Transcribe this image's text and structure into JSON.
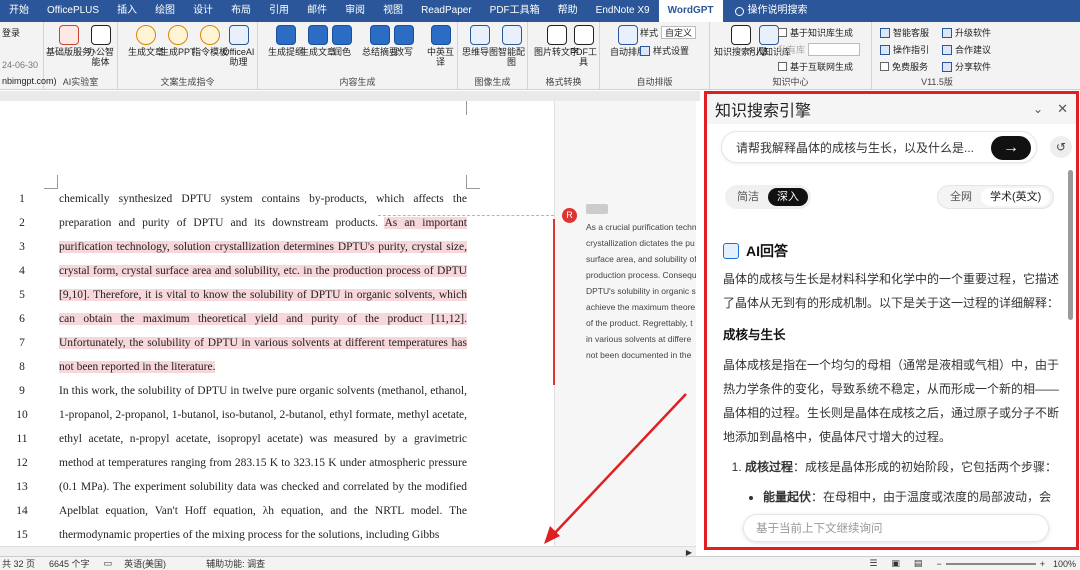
{
  "tabs": [
    "开始",
    "OfficePLUS",
    "插入",
    "绘图",
    "设计",
    "布局",
    "引用",
    "邮件",
    "审阅",
    "视图",
    "ReadPaper",
    "PDF工具箱",
    "帮助",
    "EndNote X9",
    "WordGPT",
    "操作说明搜索"
  ],
  "ribbon": {
    "login": {
      "text": "登录",
      "date": "24-06-30",
      "site": "nbimgpt.com)"
    },
    "ai_lab": {
      "label": "AI实验室",
      "buttons": [
        "基础版服务",
        "办公智能体"
      ]
    },
    "text_gen": {
      "label": "文案生成指令",
      "buttons": [
        "生成文章",
        "生成PPT",
        "指令模板",
        "OfficeAI助理"
      ]
    },
    "content_gen": {
      "label": "内容生成",
      "buttons": [
        "生成提纲",
        "生成文章",
        "润色",
        "总结摘要",
        "改写",
        "中英互译"
      ]
    },
    "image_gen": {
      "label": "图像生成",
      "buttons": [
        "思维导图",
        "智能配图"
      ]
    },
    "format_conv": {
      "label": "格式转换",
      "buttons": [
        "图片转文字",
        "PDF工具"
      ]
    },
    "auto_layout": {
      "label": "自动排版",
      "button": "自动排版",
      "style_label": "样式",
      "style_value": "自定义",
      "style_settings": "样式设置"
    },
    "knowledge": {
      "label": "知识中心",
      "buttons": [
        "知识搜索引擎",
        "个人知识库"
      ],
      "options": [
        "基于知识库生成",
        "私有库",
        "基于互联网生成"
      ]
    },
    "version": {
      "label": "V11.5版",
      "items": [
        "智能客服",
        "升级软件",
        "操作指引",
        "合作建议",
        "免费服务",
        "分享软件"
      ]
    }
  },
  "document": {
    "lines": [
      {
        "n": "1",
        "segments": [
          {
            "t": "chemically synthesized DPTU system contains by-products, which affects the",
            "h": false
          }
        ]
      },
      {
        "n": "2",
        "segments": [
          {
            "t": "preparation and purity of DPTU and its downstream products. ",
            "h": false
          },
          {
            "t": "As an important",
            "h": true
          }
        ]
      },
      {
        "n": "3",
        "segments": [
          {
            "t": "purification technology, solution crystallization determines DPTU's purity, crystal size,",
            "h": true
          }
        ]
      },
      {
        "n": "4",
        "segments": [
          {
            "t": "crystal form, crystal surface area and solubility, etc. in the production process of DPTU",
            "h": true
          }
        ]
      },
      {
        "n": "5",
        "segments": [
          {
            "t": "[9,10]. Therefore, it is vital to know the solubility of DPTU in organic solvents, which",
            "h": true
          }
        ]
      },
      {
        "n": "6",
        "segments": [
          {
            "t": "can obtain the maximum theoretical yield and purity of the product [11,12].",
            "h": true
          }
        ]
      },
      {
        "n": "7",
        "segments": [
          {
            "t": "Unfortunately, the solubility of DPTU in various solvents at different temperatures has",
            "h": true
          }
        ]
      },
      {
        "n": "8",
        "segments": [
          {
            "t": "not been reported in the literature.",
            "h": true
          }
        ]
      },
      {
        "n": "9",
        "segments": [
          {
            "t": "In this work, the solubility of DPTU in twelve pure organic solvents (methanol, ethanol,",
            "h": false
          }
        ]
      },
      {
        "n": "10",
        "segments": [
          {
            "t": "1-propanol, 2-propanol, 1-butanol, iso-butanol, 2-butanol, ethyl formate, methyl acetate,",
            "h": false
          }
        ]
      },
      {
        "n": "11",
        "segments": [
          {
            "t": "ethyl acetate, n-propyl acetate, isopropyl acetate) was measured by a gravimetric",
            "h": false
          }
        ]
      },
      {
        "n": "12",
        "segments": [
          {
            "t": "method at temperatures ranging from 283.15 K to 323.15 K under atmospheric pressure",
            "h": false
          }
        ]
      },
      {
        "n": "13",
        "segments": [
          {
            "t": "(0.1 MPa). The experiment solubility data was checked and correlated by the modified",
            "h": false
          }
        ]
      },
      {
        "n": "14",
        "segments": [
          {
            "t": "Apelblat equation, Van't Hoff equation, λh equation, and the NRTL model. The",
            "h": false
          }
        ]
      },
      {
        "n": "15",
        "segments": [
          {
            "t": "thermodynamic properties of the mixing process for the solutions, including Gibbs",
            "h": false
          }
        ]
      }
    ],
    "comment": {
      "avatar": "R",
      "lines": [
        "As a crucial purification techn",
        "crystallization dictates the pu",
        "surface area, and solubility of",
        "production process. Consequ",
        "DPTU's solubility in organic s",
        "achieve the maximum theore",
        "of the product. Regrettably, t",
        "in various solvents at differe",
        "not been documented in the"
      ]
    }
  },
  "status": {
    "pages": "共 32 页",
    "words": "6645 个字",
    "lang": "英语(美国)",
    "access": "辅助功能: 调查",
    "zoom": "100%"
  },
  "panel": {
    "title": "知识搜索引擎",
    "query": "请帮我解释晶体的成核与生长，以及什么是...",
    "send": "→",
    "mode_options": [
      "简洁",
      "深入"
    ],
    "mode_selected": 1,
    "source_options": [
      "全网",
      "学术(英文)"
    ],
    "source_selected": 1,
    "answer_title": "AI回答",
    "intro": "晶体的成核与生长是材料科学和化学中的一个重要过程，它描述了晶体从无到有的形成机制。以下是关于这一过程的详细解释：",
    "section": "成核与生长",
    "para": "晶体成核是指在一个均匀的母相（通常是液相或气相）中，由于热力学条件的变化，导致系统不稳定，从而形成一个新的相——晶体相的过程。生长则是晶体在成核之后，通过原子或分子不断地添加到晶格中，使晶体尺寸增大的过程。",
    "list_head": "成核过程",
    "list_text": "：成核是晶体形成的初始阶段，它包括两个步骤：",
    "bullet_head": "能量起伏",
    "bullet_text": "：在母相中，由于温度或浓度的局部波动，会出现能量起伏。",
    "continue_placeholder": "基于当前上下文继续询问"
  }
}
